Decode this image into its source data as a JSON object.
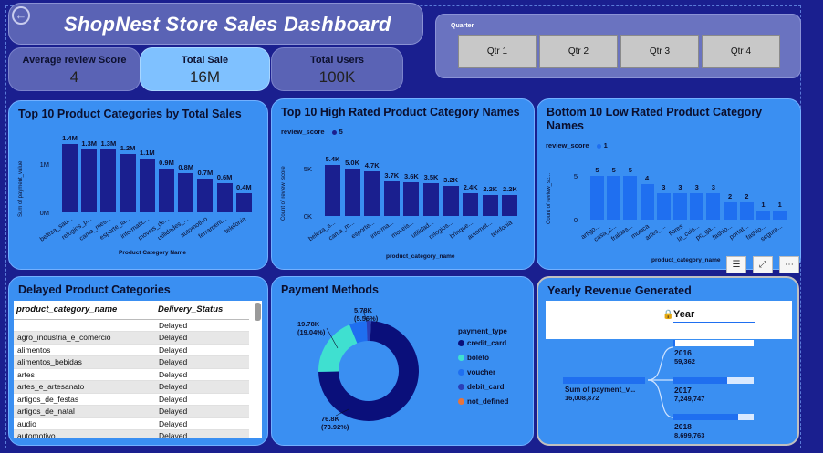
{
  "header": {
    "title": "ShopNest Store Sales Dashboard"
  },
  "kpis": [
    {
      "label": "Average review Score",
      "value": "4",
      "bg": "#5a63b5"
    },
    {
      "label": "Total Sale",
      "value": "16M",
      "bg": "#7fc1ff"
    },
    {
      "label": "Total Users",
      "value": "100K",
      "bg": "#5a63b5"
    }
  ],
  "quarter": {
    "label": "Quarter",
    "options": [
      "Qtr 1",
      "Qtr 2",
      "Qtr 3",
      "Qtr 4"
    ]
  },
  "colors": {
    "bg": "#1a1f8f",
    "card": "#3a8ff2",
    "bar_dark": "#1a1f8f",
    "bar_bright": "#1f6ff0"
  },
  "chart_data": [
    {
      "type": "bar",
      "title": "Top 10 Product Categories by Total Sales",
      "categories": [
        "beleza_sau...",
        "relogios_p...",
        "cama_mes...",
        "esporte_la...",
        "informatic...",
        "moveis_de...",
        "utilidades_...",
        "automotivo",
        "ferrament...",
        "telefonia"
      ],
      "values": [
        1.4,
        1.3,
        1.3,
        1.2,
        1.1,
        0.9,
        0.8,
        0.7,
        0.6,
        0.4
      ],
      "data_labels": [
        "1.4M",
        "1.3M",
        "1.3M",
        "1.2M",
        "1.1M",
        "0.9M",
        "0.8M",
        "0.7M",
        "0.6M",
        "0.4M"
      ],
      "yticks": [
        "1M",
        "0M"
      ],
      "xlabel": "Product Category Name",
      "ylabel": "Sum of payment_value",
      "ylim": [
        0,
        1.5
      ],
      "unit": "M"
    },
    {
      "type": "bar",
      "title": "Top 10 High Rated Product Category Names",
      "legend_title": "review_score",
      "legend_item": "5",
      "categories": [
        "beleza_s...",
        "cama_m...",
        "esporte...",
        "informa...",
        "moveis...",
        "utilidad...",
        "relogios...",
        "brinque...",
        "automot...",
        "telefonia"
      ],
      "values": [
        5.4,
        5.0,
        4.7,
        3.7,
        3.6,
        3.5,
        3.2,
        2.4,
        2.2,
        2.2
      ],
      "data_labels": [
        "5.4K",
        "5.0K",
        "4.7K",
        "3.7K",
        "3.6K",
        "3.5K",
        "3.2K",
        "2.4K",
        "2.2K",
        "2.2K"
      ],
      "yticks": [
        "5K",
        "0K"
      ],
      "xlabel": "product_category_name",
      "ylabel": "Count of review_score",
      "ylim": [
        0,
        6
      ],
      "unit": "K"
    },
    {
      "type": "bar",
      "title": "Bottom 10 Low Rated Product Category Names",
      "legend_title": "review_score",
      "legend_item": "1",
      "categories": [
        "artigo...",
        "casa_c...",
        "fraldas...",
        "musica",
        "artes_...",
        "flores",
        "la_cuis...",
        "pc_ga...",
        "fashio...",
        "portat...",
        "fashio...",
        "seguro..."
      ],
      "values": [
        5,
        5,
        5,
        4,
        3,
        3,
        3,
        3,
        2,
        2,
        1,
        1
      ],
      "data_labels": [
        "5",
        "5",
        "5",
        "4",
        "3",
        "3",
        "3",
        "3",
        "2",
        "2",
        "1",
        "1"
      ],
      "yticks": [
        "5",
        "0"
      ],
      "xlabel": "product_category_name",
      "ylabel": "Count of review_sc...",
      "ylim": [
        0,
        6
      ]
    },
    {
      "type": "pie",
      "title": "Payment Methods",
      "legend_title": "payment_type",
      "slices": [
        {
          "name": "credit_card",
          "value": 76.8,
          "label": "76.8K",
          "pct": "(73.92%)",
          "color": "#0a0f7a"
        },
        {
          "name": "boleto",
          "value": 19.78,
          "label": "19.78K",
          "pct": "(19.04%)",
          "color": "#3fe0d0"
        },
        {
          "name": "voucher",
          "value": 5.78,
          "label": "5.78K",
          "pct": "(5.56%)",
          "color": "#1f6ff0"
        },
        {
          "name": "debit_card",
          "value": 1.5,
          "label": "",
          "pct": "",
          "color": "#2a3fb8"
        },
        {
          "name": "not_defined",
          "value": 0.01,
          "label": "",
          "pct": "",
          "color": "#e8743b"
        }
      ]
    }
  ],
  "delayed": {
    "title": "Delayed Product Categories",
    "columns": [
      "product_category_name",
      "Delivery_Status"
    ],
    "rows": [
      [
        "",
        "Delayed"
      ],
      [
        "agro_industria_e_comercio",
        "Delayed"
      ],
      [
        "alimentos",
        "Delayed"
      ],
      [
        "alimentos_bebidas",
        "Delayed"
      ],
      [
        "artes",
        "Delayed"
      ],
      [
        "artes_e_artesanato",
        "Delayed"
      ],
      [
        "artigos_de_festas",
        "Delayed"
      ],
      [
        "artigos_de_natal",
        "Delayed"
      ],
      [
        "audio",
        "Delayed"
      ],
      [
        "automotivo",
        "Delayed"
      ]
    ]
  },
  "revenue": {
    "title": "Yearly Revenue Generated",
    "slicer_label": "Year",
    "root_label": "Sum of payment_v...",
    "root_value": "16,008,872",
    "years": [
      {
        "year": "2016",
        "value": "59,362",
        "fill": 0.004
      },
      {
        "year": "2017",
        "value": "7,249,747",
        "fill": 0.45
      },
      {
        "year": "2018",
        "value": "8,699,763",
        "fill": 0.54
      }
    ]
  }
}
